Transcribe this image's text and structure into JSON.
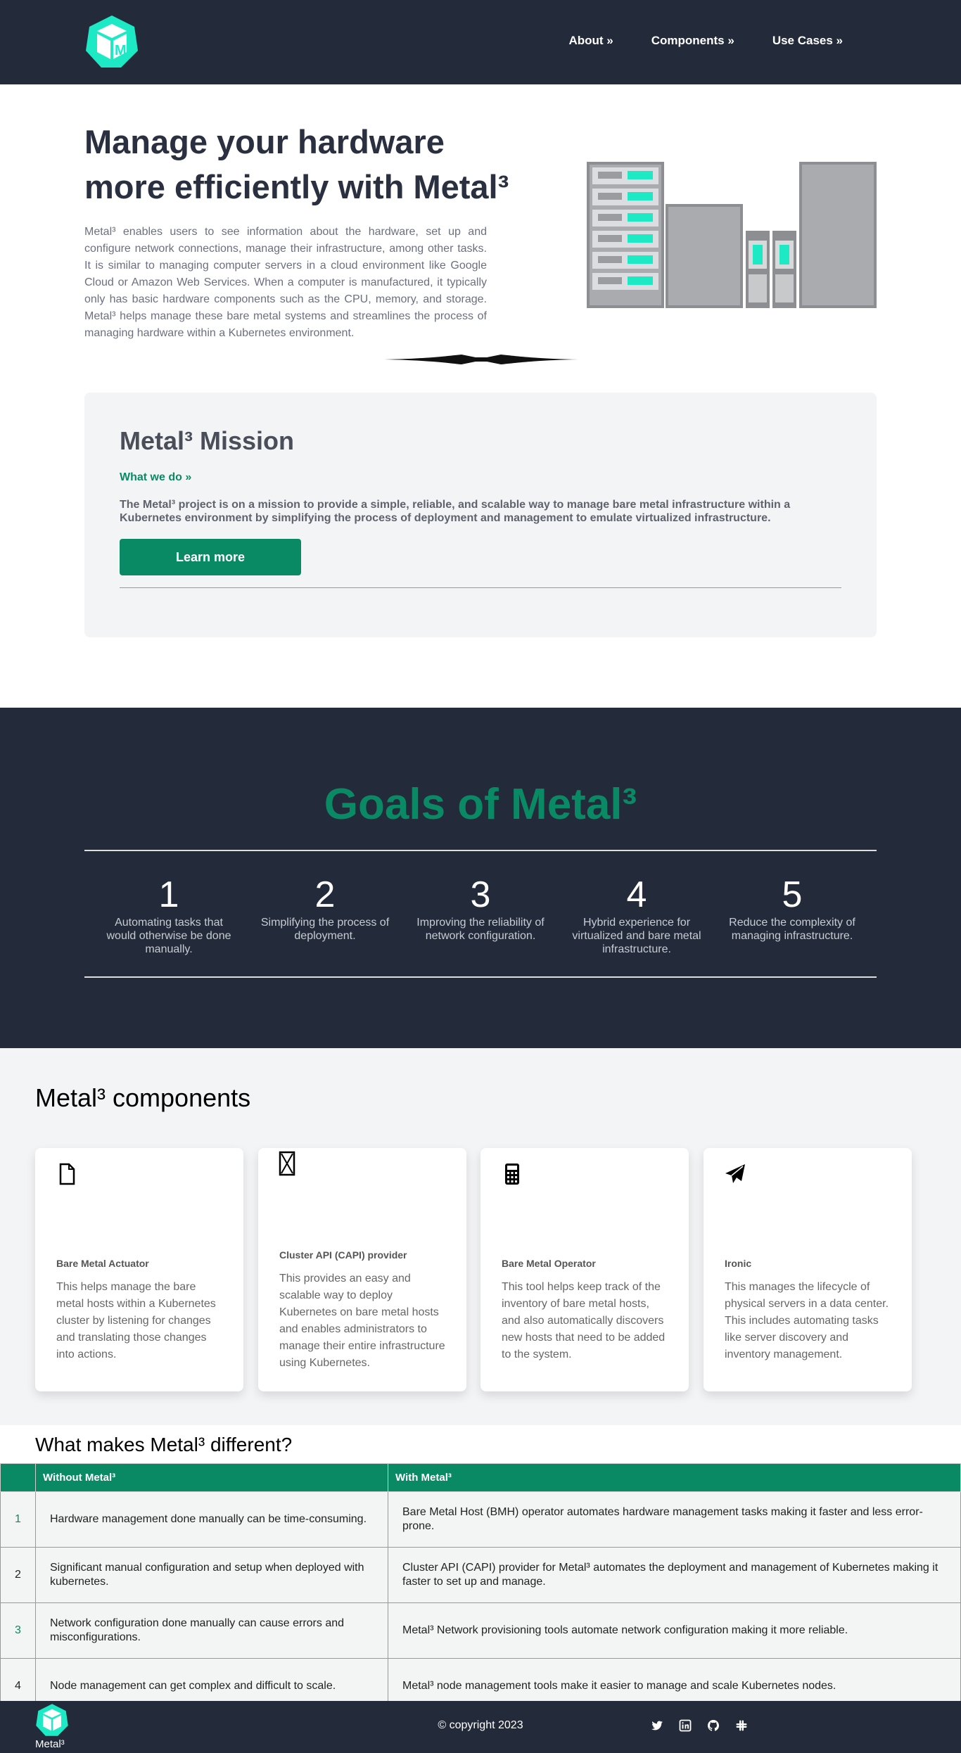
{
  "header": {
    "nav": [
      "About »",
      "Components »",
      "Use Cases »"
    ]
  },
  "hero": {
    "title": "Manage your hardware more efficiently with Metal³",
    "text": "Metal³ enables users to see information about the hardware, set up and configure network connections, manage their infrastructure, among other tasks. It is similar to managing computer servers in a cloud environment like Google Cloud or Amazon Web Services. When a computer is manufactured, it typically only has basic hardware components such as the CPU, memory, and storage. Metal³ helps manage these bare metal systems and streamlines the process of managing hardware within a Kubernetes environment."
  },
  "mission": {
    "title": "Metal³ Mission",
    "what": "What we do »",
    "desc": "The Metal³ project is on a mission to provide a simple, reliable, and scalable way to manage bare metal infrastructure within a Kubernetes environment by simplifying the process of deployment and management to emulate virtualized infrastructure.",
    "button": "Learn more"
  },
  "goals": {
    "title": "Goals of Metal³",
    "items": [
      {
        "num": "1",
        "text": "Automating tasks that would otherwise be done manually."
      },
      {
        "num": "2",
        "text": "Simplifying the process of deployment."
      },
      {
        "num": "3",
        "text": "Improving the reliability of network configuration."
      },
      {
        "num": "4",
        "text": "Hybrid experience for virtualized and bare metal infrastructure."
      },
      {
        "num": "5",
        "text": "Reduce the complexity of managing infrastructure."
      }
    ]
  },
  "components": {
    "title": "Metal³ components",
    "cards": [
      {
        "icon": "file-icon",
        "title": "Bare Metal Actuator",
        "desc": "This helps manage the bare metal hosts within a Kubernetes cluster by listening for changes and translating those changes into actions."
      },
      {
        "icon": "hourglass-icon",
        "title": "Cluster API (CAPI) provider",
        "desc": "This provides an easy and scalable way to deploy Kubernetes on bare metal hosts and enables administrators to manage their entire infrastructure using Kubernetes."
      },
      {
        "icon": "calculator-icon",
        "title": "Bare Metal Operator",
        "desc": "This tool helps keep track of the inventory of bare metal hosts, and also automatically discovers new hosts that need to be added to the system."
      },
      {
        "icon": "paper-plane-icon",
        "title": "Ironic",
        "desc": "This manages the lifecycle of physical servers in a data center. This includes automating tasks like server discovery and inventory management."
      }
    ]
  },
  "different": {
    "title": "What makes Metal³ different?",
    "headers": [
      "",
      "Without Metal³",
      "With Metal³"
    ],
    "rows": [
      [
        "1",
        "Hardware management done manually can be time-consuming.",
        "Bare Metal Host (BMH) operator automates hardware management tasks making it faster and less error-prone."
      ],
      [
        "2",
        "Significant manual configuration and setup when deployed with kubernetes.",
        "Cluster API (CAPI) provider for Metal³ automates the deployment and management of Kubernetes making it faster to set up and manage."
      ],
      [
        "3",
        "Network configuration done manually can cause errors and misconfigurations.",
        "Metal³ Network provisioning tools automate network configuration making it more reliable."
      ],
      [
        "4",
        "Node management can get complex and difficult to scale.",
        "Metal³ node management tools make it easier to manage and scale Kubernetes nodes."
      ]
    ]
  },
  "footer": {
    "name": "Metal³",
    "copyright": "© copyright 2023",
    "socials": [
      "twitter-icon",
      "linkedin-icon",
      "github-icon",
      "slack-icon"
    ]
  },
  "colors": {
    "dark": "#232b3a",
    "accent": "#0a8a64",
    "teal": "#1de9c4"
  }
}
